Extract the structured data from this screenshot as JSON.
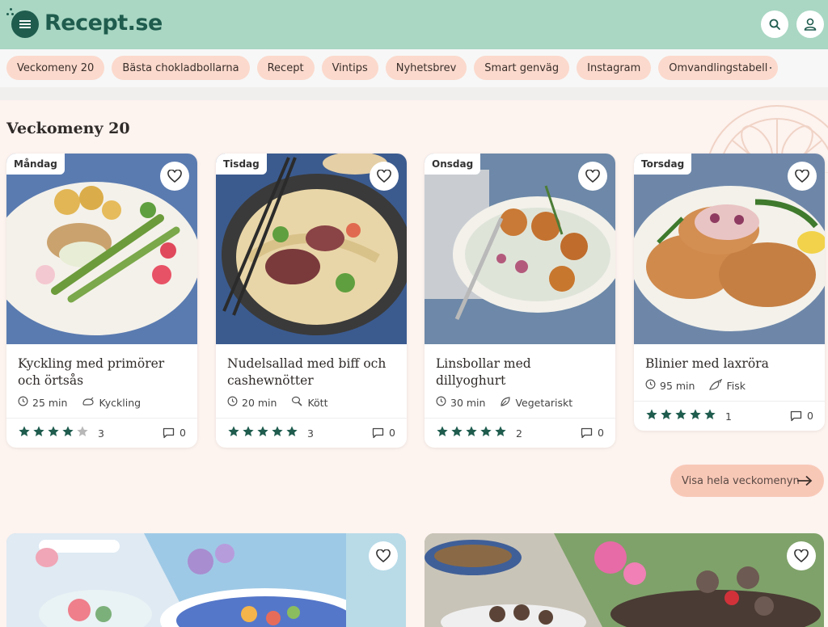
{
  "header": {
    "logo_text": "Recept.se",
    "menu_icon": "menu-icon",
    "search_icon": "search-icon",
    "user_icon": "user-icon"
  },
  "nav": {
    "pills": [
      "Veckomeny 20",
      "Bästa chokladbollarna",
      "Recept",
      "Vintips",
      "Nyhetsbrev",
      "Smart genväg",
      "Instagram",
      "Omvandlingstabell"
    ]
  },
  "section": {
    "title": "Veckomeny 20",
    "cta_label": "Visa hela veckomenyn"
  },
  "recipes": [
    {
      "day": "Måndag",
      "title": "Kyckling med primörer och örtsås",
      "time": "25 min",
      "category": "Kyckling",
      "category_icon": "chicken-icon",
      "stars": 4,
      "rating_count": "3",
      "comments": "0"
    },
    {
      "day": "Tisdag",
      "title": "Nudelsallad med biff och cashewnötter",
      "time": "20 min",
      "category": "Kött",
      "category_icon": "meat-icon",
      "stars": 5,
      "rating_count": "3",
      "comments": "0"
    },
    {
      "day": "Onsdag",
      "title": "Linsbollar med dillyoghurt",
      "time": "30 min",
      "category": "Vegetariskt",
      "category_icon": "leaf-icon",
      "stars": 5,
      "rating_count": "2",
      "comments": "0"
    },
    {
      "day": "Torsdag",
      "title": "Blinier med laxröra",
      "time": "95 min",
      "category": "Fisk",
      "category_icon": "fish-icon",
      "stars": 5,
      "rating_count": "1",
      "comments": "0"
    }
  ],
  "colors": {
    "header_bg": "#a9d7c3",
    "brand_green": "#1f5c4e",
    "pill_bg": "#fbd9cc",
    "page_bg": "#fdf3ef",
    "cta_bg": "#f8c8b7",
    "star_filled": "#1f5c4e",
    "star_empty": "#b8b8b8"
  }
}
